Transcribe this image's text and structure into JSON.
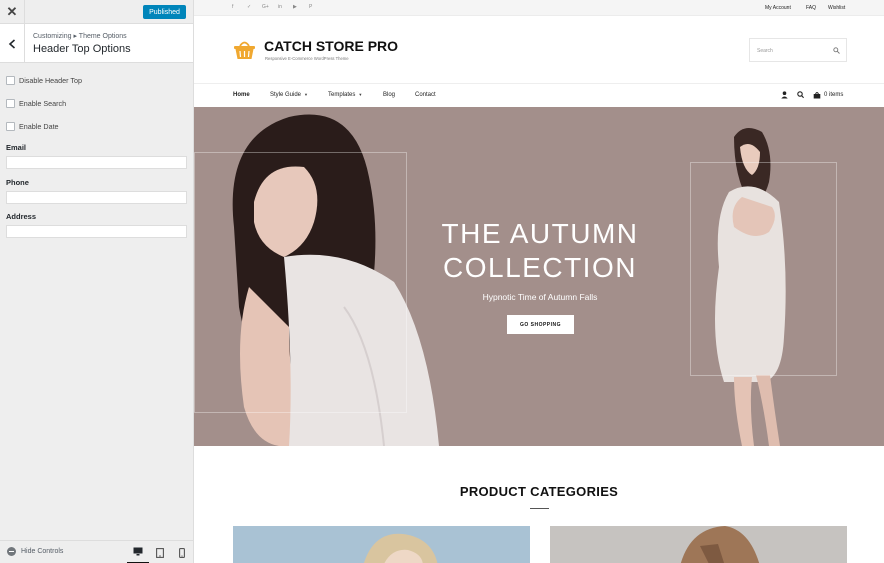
{
  "customizer": {
    "close_icon": "close-icon",
    "publish_label": "Published",
    "breadcrumb": "Customizing ▸ Theme Options",
    "section_title": "Header Top Options",
    "controls": [
      {
        "label": "Disable Header Top",
        "checked": false
      },
      {
        "label": "Enable Search",
        "checked": false
      },
      {
        "label": "Enable Date",
        "checked": false
      }
    ],
    "fields": [
      {
        "label": "Email",
        "value": ""
      },
      {
        "label": "Phone",
        "value": ""
      },
      {
        "label": "Address",
        "value": ""
      }
    ],
    "footer": {
      "hide_controls_label": "Hide Controls",
      "devices": [
        "desktop",
        "tablet",
        "mobile"
      ],
      "active_device": "desktop"
    }
  },
  "site": {
    "social_icons": [
      "facebook-icon",
      "twitter-icon",
      "google-plus-icon",
      "linkedin-icon",
      "youtube-icon",
      "pinterest-icon"
    ],
    "social_glyphs": [
      "f",
      "✓",
      "G+",
      "in",
      "▶",
      "P"
    ],
    "top_links": [
      "My Account",
      "FAQ",
      "Wishlist"
    ],
    "title": "CATCH STORE PRO",
    "tagline": "Responsive E-Commerce WordPress Theme",
    "search_placeholder": "Search",
    "nav": [
      {
        "label": "Home",
        "dropdown": false
      },
      {
        "label": "Style Guide",
        "dropdown": true
      },
      {
        "label": "Templates",
        "dropdown": true
      },
      {
        "label": "Blog",
        "dropdown": false
      },
      {
        "label": "Contact",
        "dropdown": false
      }
    ],
    "cart_label": "0 items",
    "hero": {
      "title_line1": "THE AUTUMN",
      "title_line2": "COLLECTION",
      "subtitle": "Hypnotic Time of Autumn Falls",
      "button_label": "GO SHOPPING"
    },
    "section_heading": "PRODUCT CATEGORIES"
  },
  "colors": {
    "accent": "#0085ba",
    "hero_bg": "#a38f8b",
    "logo_orange": "#f0a830"
  }
}
